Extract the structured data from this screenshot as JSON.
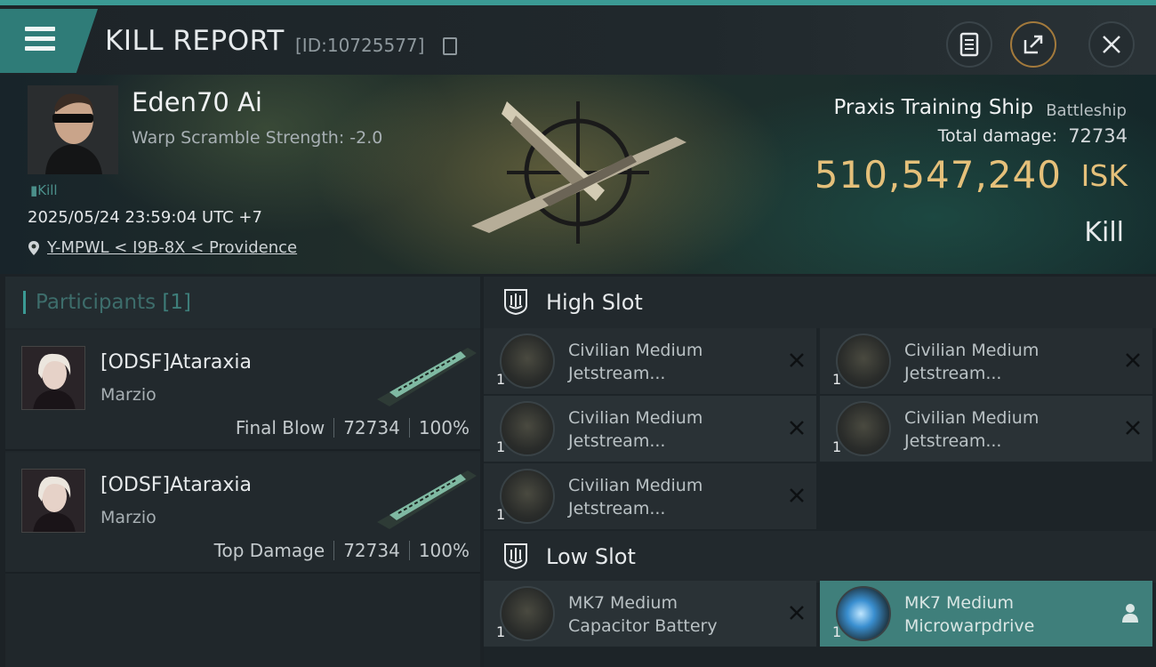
{
  "header": {
    "title": "KILL REPORT",
    "report_id": "[ID:10725577]"
  },
  "victim": {
    "name": "Eden70 Ai",
    "warp": "Warp Scramble Strength: -2.0",
    "tag": "Kill",
    "datetime": "2025/05/24 23:59:04 UTC +7",
    "location": "Y-MPWL < I9B-8X < Providence",
    "ship_name": "Praxis Training Ship",
    "ship_class": "Battleship",
    "damage_label": "Total damage:",
    "damage_value": "72734",
    "isk_value": "510,547,240",
    "isk_unit": "ISK",
    "result": "Kill"
  },
  "participants": {
    "label": "Participants",
    "count": "[1]",
    "rows": [
      {
        "name": "[ODSF]Ataraxia",
        "corp": "Marzio",
        "role": "Final Blow",
        "damage": "72734",
        "percent": "100%"
      },
      {
        "name": "[ODSF]Ataraxia",
        "corp": "Marzio",
        "role": "Top Damage",
        "damage": "72734",
        "percent": "100%"
      }
    ]
  },
  "fitting": {
    "high_slot_label": "High Slot",
    "low_slot_label": "Low Slot",
    "high_slot": [
      {
        "qty": "1",
        "line1": "Civilian Medium",
        "line2": "Jetstream..."
      },
      {
        "qty": "1",
        "line1": "Civilian Medium",
        "line2": "Jetstream..."
      },
      {
        "qty": "1",
        "line1": "Civilian Medium",
        "line2": "Jetstream..."
      },
      {
        "qty": "1",
        "line1": "Civilian Medium",
        "line2": "Jetstream..."
      },
      {
        "qty": "1",
        "line1": "Civilian Medium",
        "line2": "Jetstream..."
      }
    ],
    "low_slot": [
      {
        "qty": "1",
        "line1": "MK7 Medium",
        "line2": "Capacitor Battery"
      },
      {
        "qty": "1",
        "line1": "MK7 Medium",
        "line2": "Microwarpdrive"
      }
    ]
  },
  "colors": {
    "accent": "#3b9a94",
    "isk": "#e5c07a",
    "active_module": "#3f7f7b"
  }
}
